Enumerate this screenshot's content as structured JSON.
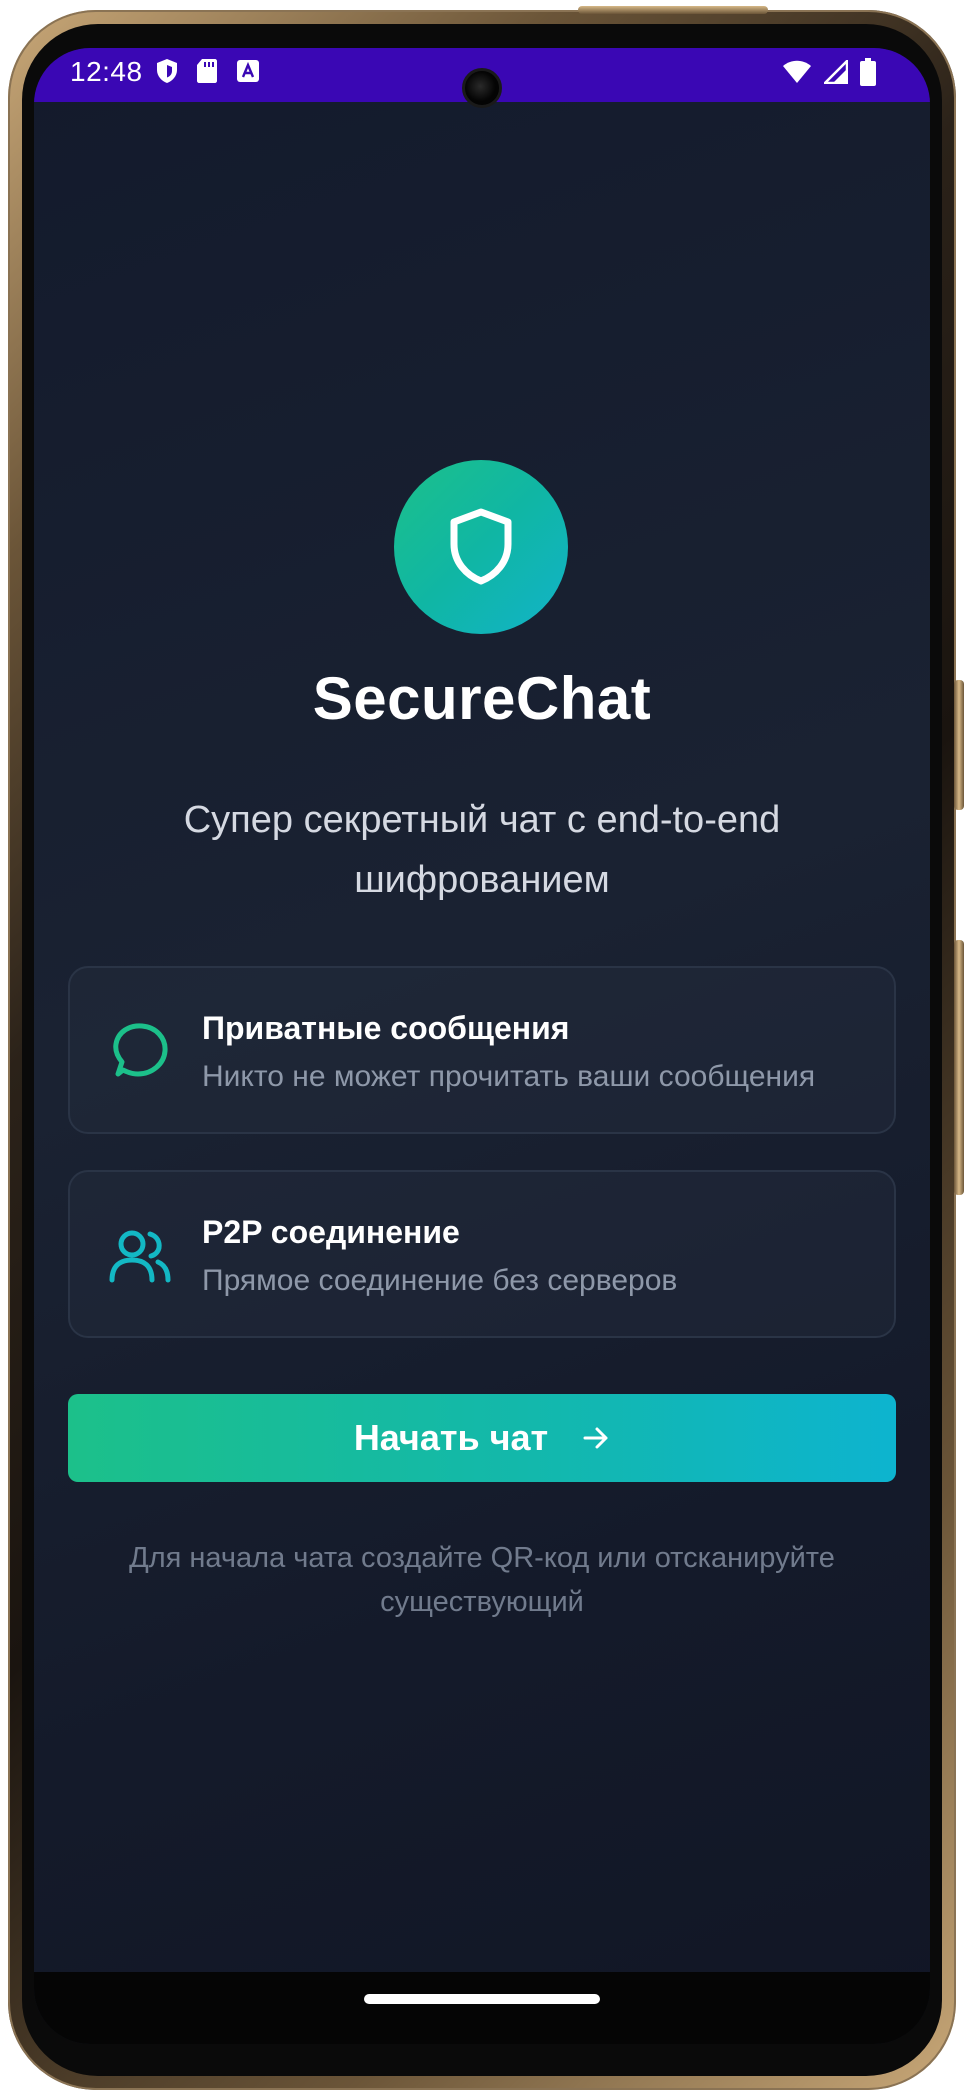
{
  "status_bar": {
    "time": "12:48",
    "icons": [
      "shield-icon",
      "sd-card-icon",
      "translate-icon",
      "wifi-icon",
      "signal-icon",
      "battery-icon"
    ],
    "color": "#3a07b4"
  },
  "app": {
    "title": "SecureChat",
    "subtitle": "Супер секретный чат с end-to-end шифрованием",
    "logo_icon": "shield-icon",
    "accent_start": "#1cc08a",
    "accent_end": "#0db4cf"
  },
  "features": [
    {
      "icon": "chat-bubble-icon",
      "title": "Приватные сообщения",
      "description": "Никто не может прочитать ваши сообщения"
    },
    {
      "icon": "users-icon",
      "title": "P2P соединение",
      "description": "Прямое соединение без серверов"
    }
  ],
  "start_button": {
    "label": "Начать чат",
    "icon": "arrow-right-icon"
  },
  "hint": "Для начала чата создайте QR-код или отсканируйте существующий"
}
